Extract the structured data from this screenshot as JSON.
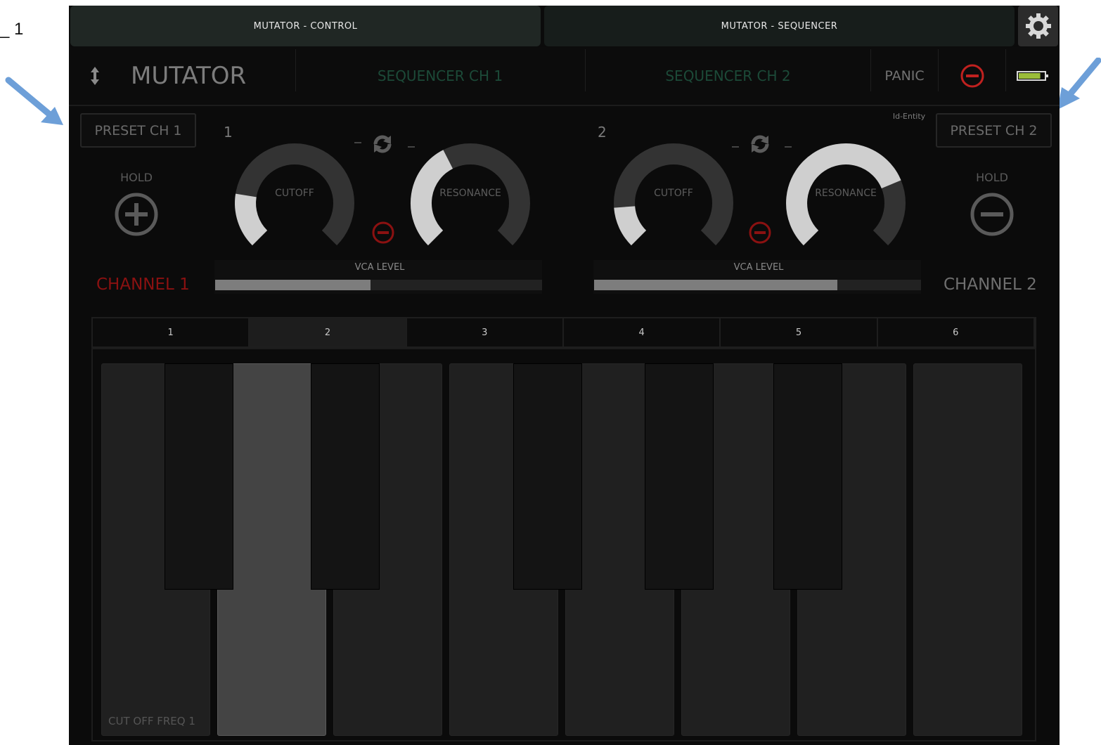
{
  "annotation": {
    "left_fragment": "_ 1"
  },
  "tabs": [
    {
      "label": "MUTATOR - CONTROL",
      "active": true
    },
    {
      "label": "MUTATOR - SEQUENCER",
      "active": false
    }
  ],
  "header": {
    "title": "MUTATOR",
    "seq_ch1": "SEQUENCER CH 1",
    "seq_ch2": "SEQUENCER CH 2",
    "panic": "PANIC",
    "battery_level": 0.85
  },
  "credit": "Id-Entity",
  "channel1": {
    "preset": "PRESET CH 1",
    "hold": "HOLD",
    "number": "1",
    "cutoff_label": "CUTOFF",
    "cutoff_value": 0.2,
    "resonance_label": "RESONANCE",
    "resonance_value": 0.4,
    "vca_label": "VCA LEVEL",
    "vca_value": 0.475,
    "name": "CHANNEL 1",
    "name_color": "#8b1111"
  },
  "channel2": {
    "preset": "PRESET CH 2",
    "hold": "HOLD",
    "number": "2",
    "cutoff_label": "CUTOFF",
    "cutoff_value": 0.15,
    "resonance_label": "RESONANCE",
    "resonance_value": 0.75,
    "vca_label": "VCA LEVEL",
    "vca_value": 0.745,
    "name": "CHANNEL 2",
    "name_color": "#6f6f6f"
  },
  "keyboard_tabs": [
    "1",
    "2",
    "3",
    "4",
    "5",
    "6"
  ],
  "keyboard_active_tab": 1,
  "keyboard": {
    "pressed_white_key": 1,
    "first_key_label": "CUT OFF FREQ 1"
  },
  "colors": {
    "accent_green": "#1c4a38",
    "danger_red": "#c0211f",
    "battery_green": "#9bbd3a"
  },
  "icons": {
    "settings": "gear-icon",
    "sort": "up-down-arrow-icon",
    "link": "refresh-icon",
    "hold_ch1": "plus-circle-icon",
    "hold_ch2": "minus-circle-icon",
    "remove": "minus-circle-icon",
    "battery": "battery-icon"
  }
}
